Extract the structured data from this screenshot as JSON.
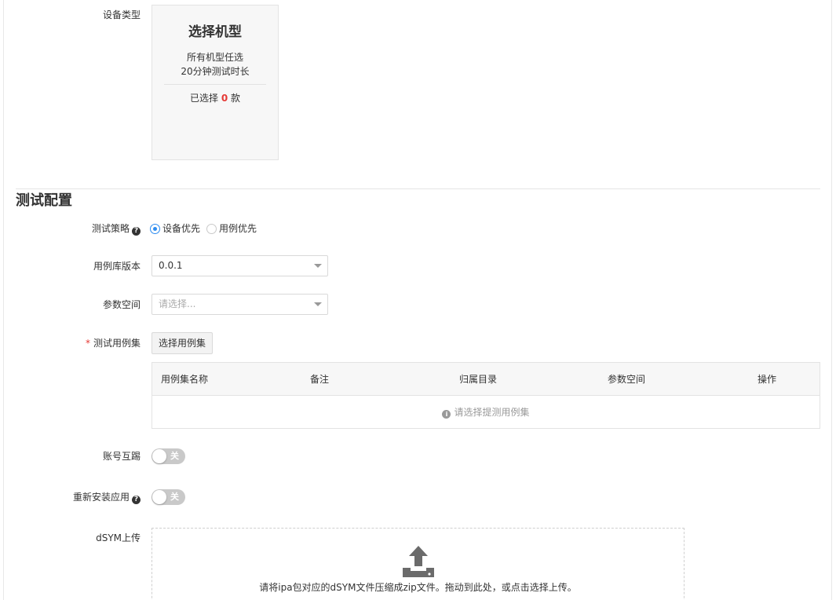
{
  "device": {
    "label": "设备类型",
    "card_title": "选择机型",
    "desc_line1": "所有机型任选",
    "desc_line2": "20分钟测试时长",
    "chosen_prefix": "已选择",
    "chosen_count": "0",
    "chosen_suffix": "款"
  },
  "section": {
    "title": "测试配置"
  },
  "strategy": {
    "label": "测试策略",
    "options": [
      {
        "label": "设备优先",
        "checked": true
      },
      {
        "label": "用例优先",
        "checked": false
      }
    ]
  },
  "library_version": {
    "label": "用例库版本",
    "value": "0.0.1"
  },
  "param_space": {
    "label": "参数空间",
    "placeholder": "请选择..."
  },
  "test_suite": {
    "label": "测试用例集",
    "button_label": "选择用例集",
    "columns": [
      "用例集名称",
      "备注",
      "归属目录",
      "参数空间",
      "操作"
    ],
    "empty_text": "请选择提测用例集"
  },
  "account_kick": {
    "label": "账号互踢",
    "state": "关"
  },
  "reinstall": {
    "label": "重新安装应用",
    "state": "关"
  },
  "dsym": {
    "label": "dSYM上传",
    "hint": "请将ipa包对应的dSYM文件压缩成zip文件。拖动到此处，或点击选择上传。"
  },
  "colors": {
    "accent": "#2d8cf0",
    "required": "#e53935",
    "switch_off": "#c9c9c9"
  }
}
